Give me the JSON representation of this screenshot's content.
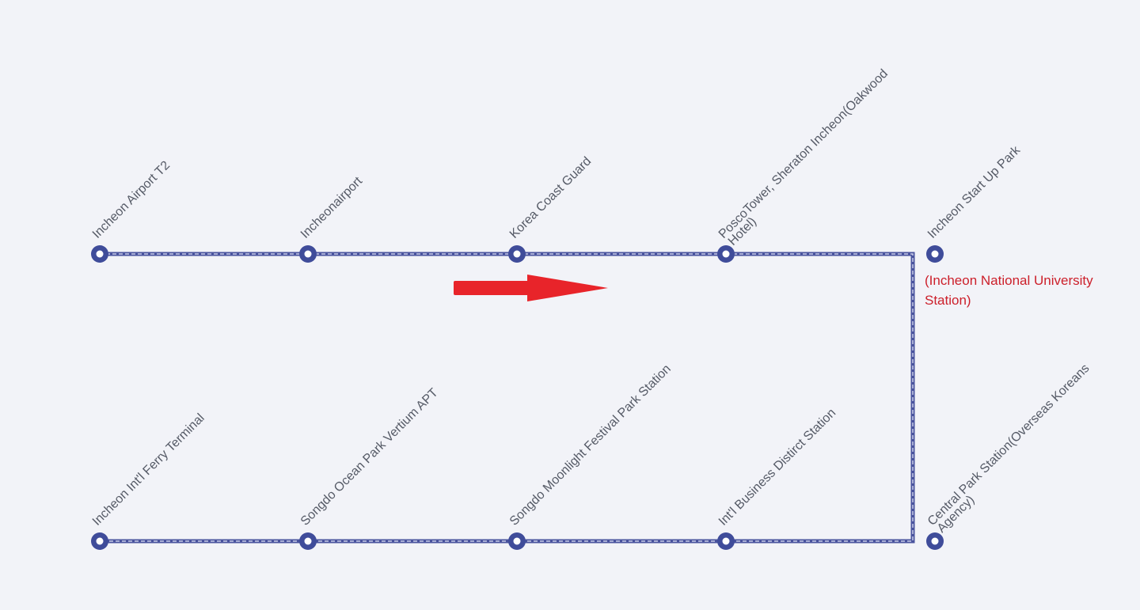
{
  "colors": {
    "route_line": "#4a549e",
    "route_dash": "#c9cde8",
    "station_ring": "#3f4c9a",
    "station_center": "#ffffff",
    "label_text": "#555a66",
    "note_text": "#cc1f2a",
    "arrow": "#e8242a",
    "background": "#f2f3f8"
  },
  "direction_arrow": {
    "icon": "arrow-right-icon",
    "direction": "right"
  },
  "stations": [
    {
      "id": "incheon-airport-t2",
      "label": "Incheon Airport T2",
      "row": "top"
    },
    {
      "id": "incheonairport",
      "label": "Incheonairport",
      "row": "top"
    },
    {
      "id": "korea-coast-guard",
      "label": "Korea Coast Guard",
      "row": "top"
    },
    {
      "id": "posco-tower",
      "label": "PoscoTower, Sheraton Incheon(Oakwood",
      "label_line2": "Hotel)",
      "row": "top"
    },
    {
      "id": "incheon-start-up-park",
      "label": "Incheon Start Up Park",
      "row": "top",
      "note": "(Incheon National University Station)"
    },
    {
      "id": "incheon-intl-ferry-terminal",
      "label": "Incheon Int'l Ferry Terminal",
      "row": "bottom"
    },
    {
      "id": "songdo-ocean-park",
      "label": "Songdo Ocean Park Vertium APT",
      "row": "bottom"
    },
    {
      "id": "songdo-moonlight",
      "label": "Songdo Moonlight Festival Park Station",
      "row": "bottom"
    },
    {
      "id": "intl-business-district",
      "label": "Int'l Business Distirct Station",
      "row": "bottom"
    },
    {
      "id": "central-park",
      "label": "Central Park Station(Overseas Koreans",
      "label_line2": "Agency)",
      "row": "bottom"
    }
  ]
}
